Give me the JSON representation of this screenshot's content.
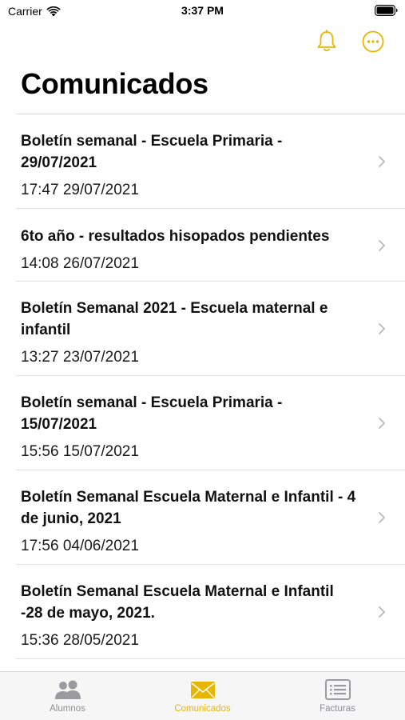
{
  "status_bar": {
    "carrier": "Carrier",
    "time": "3:37 PM"
  },
  "nav": {
    "actions": [
      {
        "icon": "bell-icon"
      },
      {
        "icon": "more-icon"
      }
    ]
  },
  "page": {
    "title": "Comunicados"
  },
  "items": [
    {
      "title": "Boletín semanal - Escuela Primaria - 29/07/2021",
      "date": "17:47 29/07/2021"
    },
    {
      "title": "6to año - resultados hisopados pendientes",
      "date": "14:08 26/07/2021"
    },
    {
      "title": "Boletín Semanal 2021 - Escuela maternal e infantil",
      "date": "13:27 23/07/2021"
    },
    {
      "title": "Boletín semanal - Escuela Primaria - 15/07/2021",
      "date": "15:56 15/07/2021"
    },
    {
      "title": "Boletín Semanal Escuela Maternal e Infantil - 4 de junio, 2021",
      "date": "17:56 04/06/2021"
    },
    {
      "title": "Boletín Semanal Escuela Maternal e Infantil -28 de mayo, 2021.",
      "date": "15:36 28/05/2021"
    }
  ],
  "tab_bar": {
    "tabs": [
      {
        "label": "Alumnos",
        "icon": "people-icon",
        "active": false
      },
      {
        "label": "Comunicados",
        "icon": "envelope-icon",
        "active": true
      },
      {
        "label": "Facturas",
        "icon": "invoice-icon",
        "active": false
      }
    ]
  },
  "colors": {
    "accent": "#e8b500",
    "inactive": "#8e8e93"
  }
}
